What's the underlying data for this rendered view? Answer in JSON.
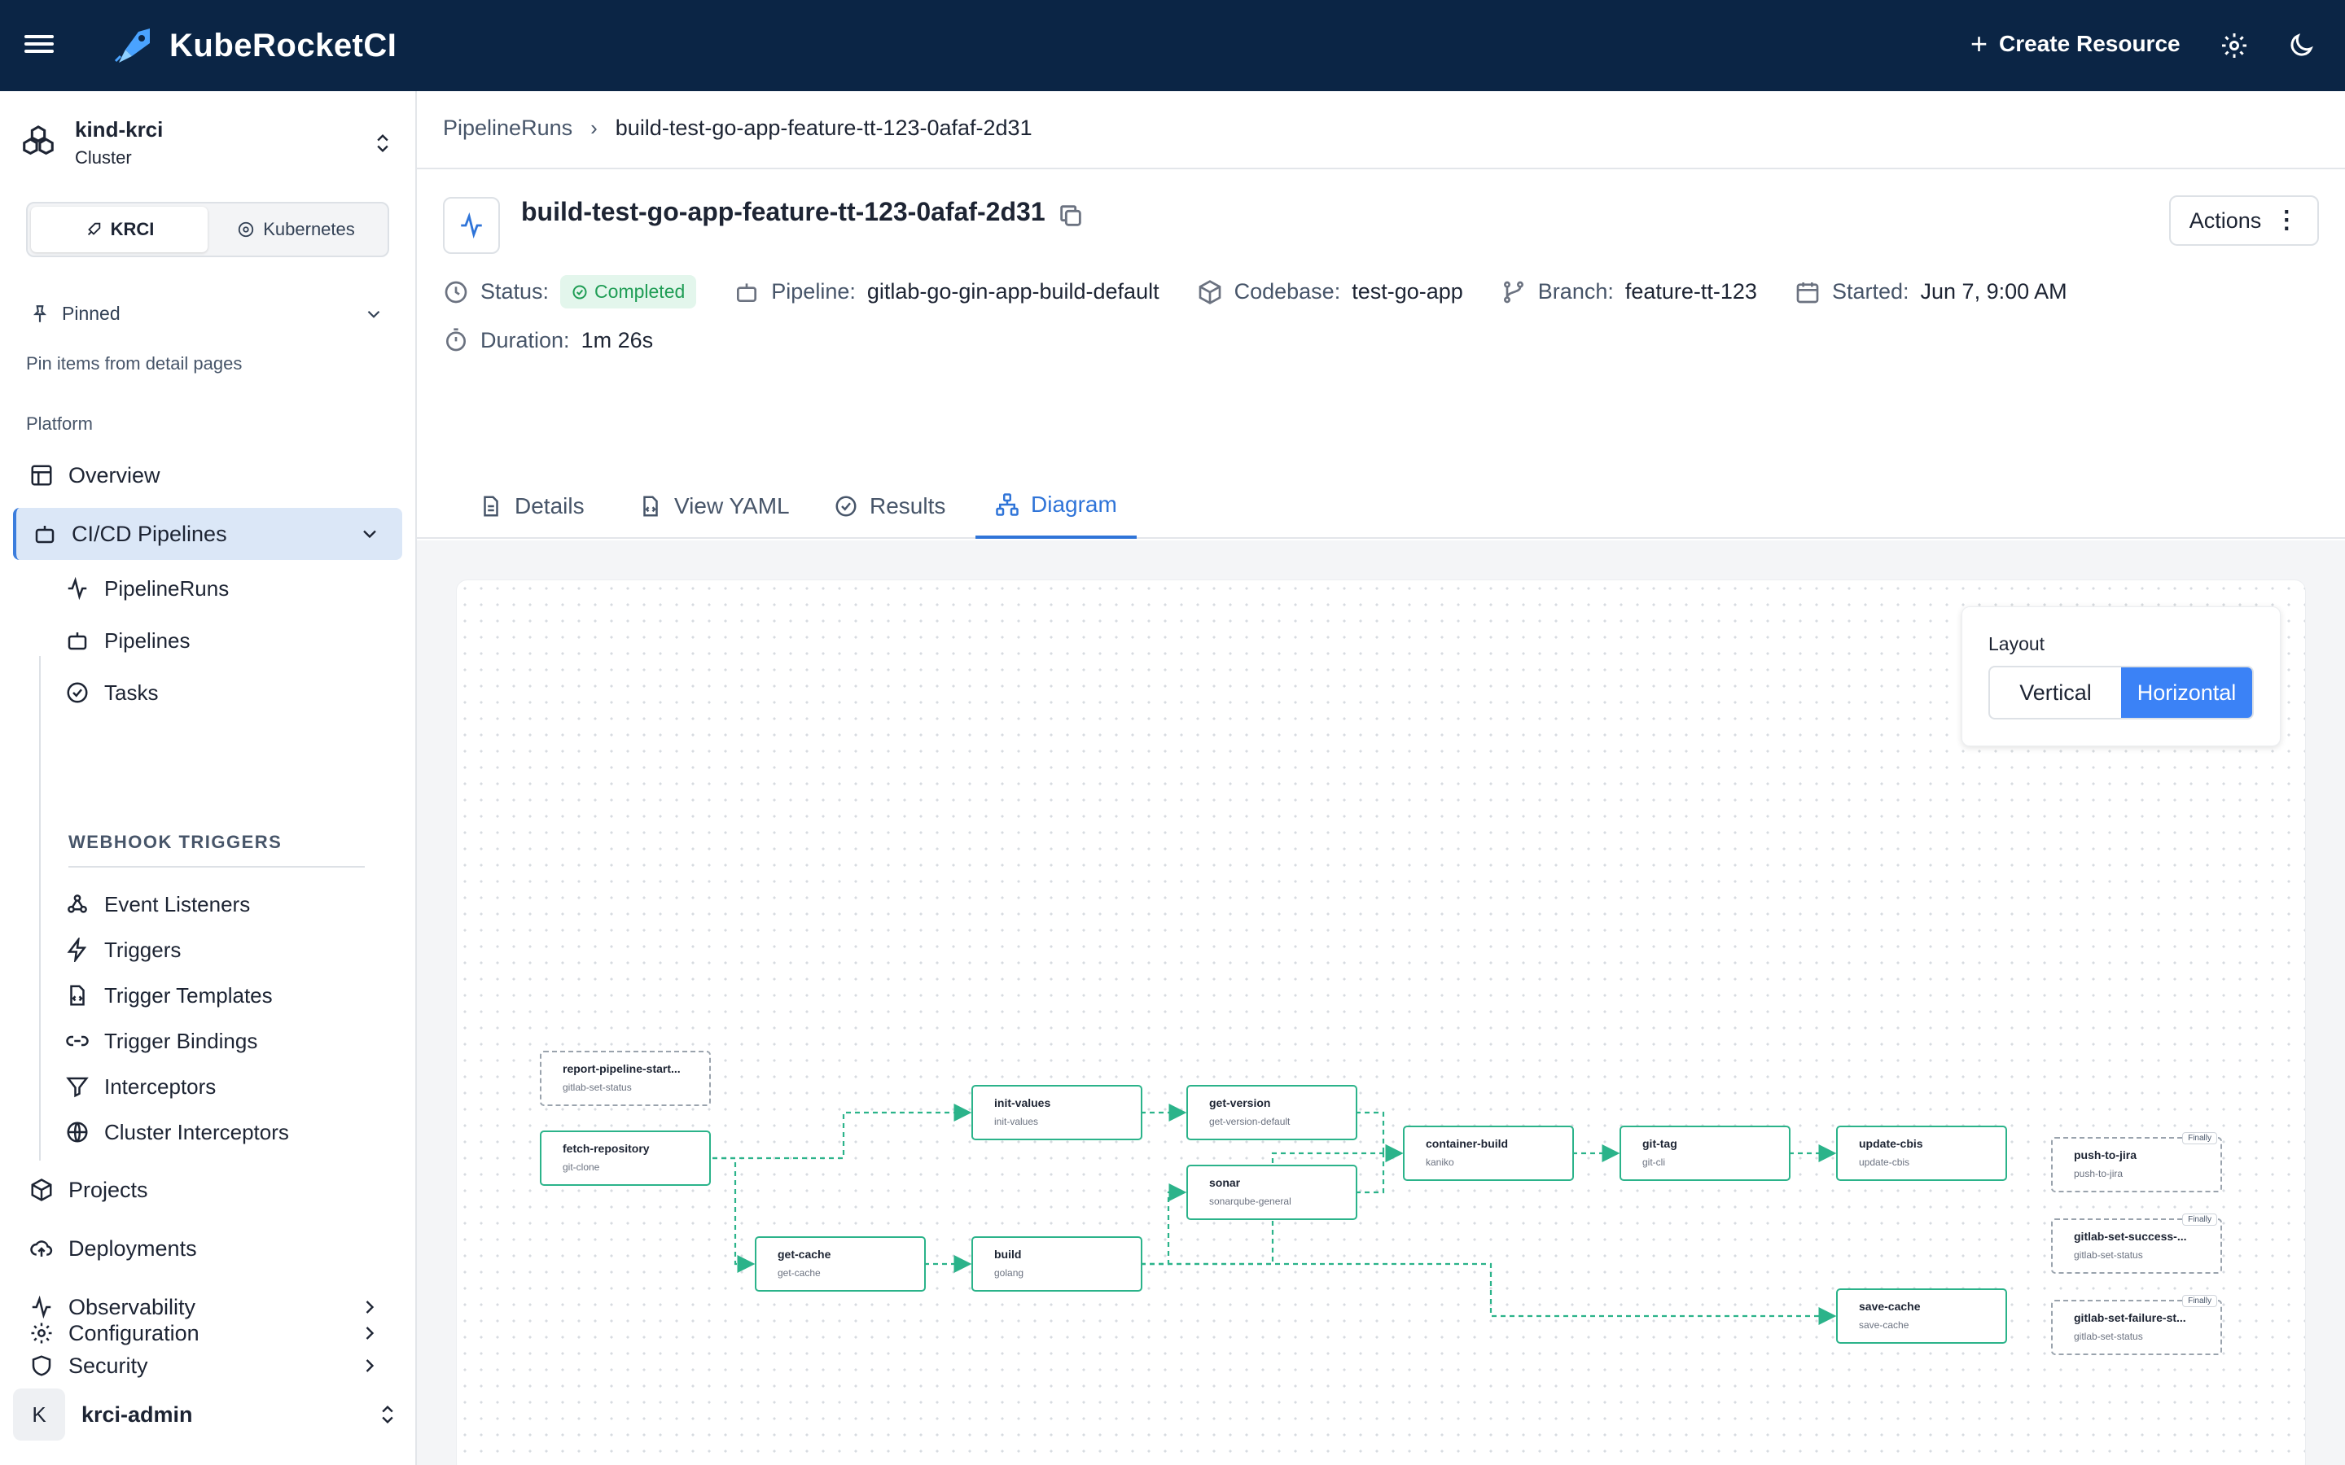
{
  "app": {
    "title": "KubeRocketCI"
  },
  "topbar": {
    "create_label": "Create Resource",
    "icons": [
      "menu-icon",
      "rocket-logo-icon",
      "plus-icon",
      "gear-icon",
      "moon-icon"
    ]
  },
  "sidebar": {
    "cluster": {
      "name": "kind-krci",
      "type": "Cluster"
    },
    "switcher": {
      "krci": "KRCI",
      "kubernetes": "Kubernetes"
    },
    "pinned": {
      "label": "Pinned",
      "hint": "Pin items from detail pages"
    },
    "section_platform": "Platform",
    "items": {
      "overview": "Overview",
      "cicd": "CI/CD Pipelines",
      "pipelineruns": "PipelineRuns",
      "pipelines": "Pipelines",
      "tasks": "Tasks",
      "webhook_triggers": "WEBHOOK TRIGGERS",
      "event_listeners": "Event Listeners",
      "triggers": "Triggers",
      "trigger_templates": "Trigger Templates",
      "trigger_bindings": "Trigger Bindings",
      "interceptors": "Interceptors",
      "cluster_interceptors": "Cluster Interceptors",
      "projects": "Projects",
      "deployments": "Deployments",
      "observability": "Observability",
      "security": "Security",
      "configuration": "Configuration"
    },
    "user": {
      "initial": "K",
      "name": "krci-admin"
    }
  },
  "breadcrumb": {
    "parent": "PipelineRuns",
    "current": "build-test-go-app-feature-tt-123-0afaf-2d31"
  },
  "header": {
    "title": "build-test-go-app-feature-tt-123-0afaf-2d31",
    "actions_label": "Actions",
    "status_label": "Status:",
    "status_value": "Completed",
    "pipeline_label": "Pipeline:",
    "pipeline_value": "gitlab-go-gin-app-build-default",
    "codebase_label": "Codebase:",
    "codebase_value": "test-go-app",
    "branch_label": "Branch:",
    "branch_value": "feature-tt-123",
    "started_label": "Started:",
    "started_value": "Jun 7, 9:00 AM",
    "duration_label": "Duration:",
    "duration_value": "1m 26s"
  },
  "tabs": {
    "details": "Details",
    "yaml": "View YAML",
    "results": "Results",
    "diagram": "Diagram",
    "active": "Diagram"
  },
  "layout_panel": {
    "title": "Layout",
    "vertical": "Vertical",
    "horizontal": "Horizontal",
    "selected": "Horizontal"
  },
  "colors": {
    "topbar": "#0b2545",
    "accent": "#2f74d8",
    "success": "#1f9d55",
    "edge": "#2bb38a"
  },
  "diagram": {
    "nodes": [
      {
        "id": "report",
        "name": "report-pipeline-start...",
        "task": "gitlab-set-status",
        "style": "dashed"
      },
      {
        "id": "fetch",
        "name": "fetch-repository",
        "task": "git-clone"
      },
      {
        "id": "init",
        "name": "init-values",
        "task": "init-values"
      },
      {
        "id": "getversion",
        "name": "get-version",
        "task": "get-version-default"
      },
      {
        "id": "sonar",
        "name": "sonar",
        "task": "sonarqube-general"
      },
      {
        "id": "getcache",
        "name": "get-cache",
        "task": "get-cache"
      },
      {
        "id": "build",
        "name": "build",
        "task": "golang"
      },
      {
        "id": "container",
        "name": "container-build",
        "task": "kaniko"
      },
      {
        "id": "gittag",
        "name": "git-tag",
        "task": "git-cli"
      },
      {
        "id": "updatecbis",
        "name": "update-cbis",
        "task": "update-cbis"
      },
      {
        "id": "savecache",
        "name": "save-cache",
        "task": "save-cache"
      },
      {
        "id": "jira",
        "name": "push-to-jira",
        "task": "push-to-jira",
        "style": "dashed",
        "tag": "Finally"
      },
      {
        "id": "success",
        "name": "gitlab-set-success-...",
        "task": "gitlab-set-status",
        "style": "dashed",
        "tag": "Finally"
      },
      {
        "id": "failure",
        "name": "gitlab-set-failure-st...",
        "task": "gitlab-set-status",
        "style": "dashed",
        "tag": "Finally"
      }
    ]
  }
}
